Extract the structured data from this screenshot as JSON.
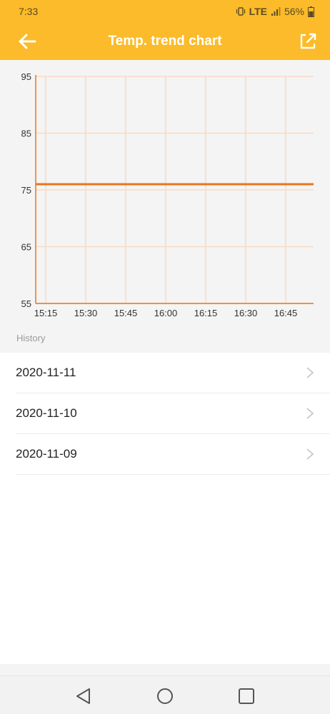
{
  "status_bar": {
    "time": "7:33",
    "network": "LTE",
    "battery": "56%"
  },
  "header": {
    "title": "Temp. trend chart",
    "back_icon": "arrow-left-icon",
    "share_icon": "external-link-icon"
  },
  "chart_data": {
    "type": "line",
    "title": "",
    "xlabel": "",
    "ylabel": "",
    "x": [
      "15:15",
      "15:30",
      "15:45",
      "16:00",
      "16:15",
      "16:30",
      "16:45"
    ],
    "y_ticks": [
      55,
      65,
      75,
      85,
      95
    ],
    "ylim": [
      55,
      95
    ],
    "series": [
      {
        "values": [
          76,
          76,
          76,
          76,
          76,
          76,
          76,
          76
        ]
      }
    ],
    "grid": true,
    "line_color": "#e8761a",
    "grid_color": "#f9d9c4"
  },
  "history": {
    "label": "History",
    "items": [
      {
        "date": "2020-11-11"
      },
      {
        "date": "2020-11-10"
      },
      {
        "date": "2020-11-09"
      }
    ]
  },
  "colors": {
    "accent": "#fbbb2a",
    "chart_line": "#e8761a"
  }
}
